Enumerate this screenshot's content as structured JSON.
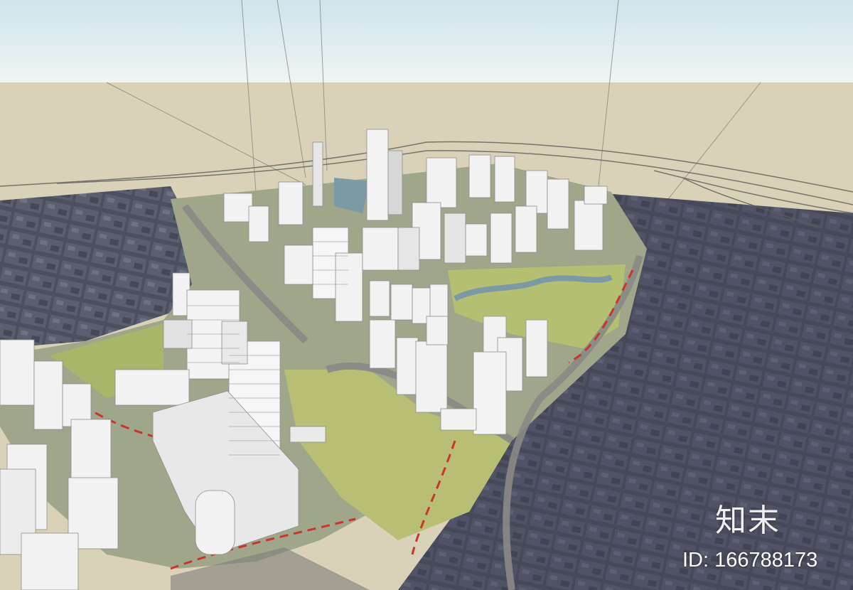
{
  "scene": {
    "description_kind": "3D massing model of urban district over aerial map",
    "colors": {
      "sky_top": "#cde3e9",
      "sky_bottom": "#eef3f3",
      "ground": "#d9d2b8",
      "aerial": "#4a4d5a",
      "park": "#a9b76a",
      "building": "#f2f2f2",
      "building_shade": "#c9c9c9",
      "road": "#8a8a86",
      "red_line": "#c9352c"
    }
  },
  "watermark": {
    "logo": "知末",
    "id_text": "ID: 166788173"
  }
}
